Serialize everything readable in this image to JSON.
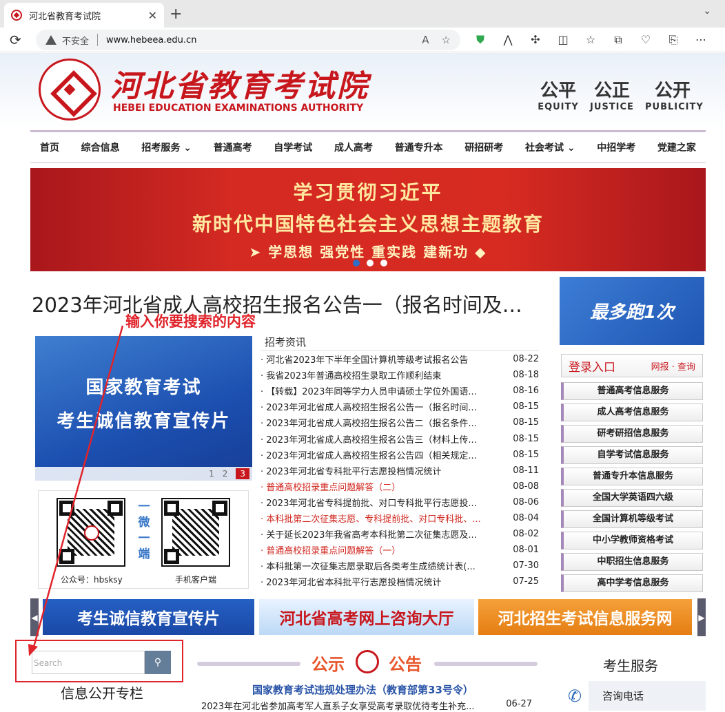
{
  "browser": {
    "tab_title": "河北省教育考试院",
    "close_glyph": "✕",
    "new_tab_glyph": "+",
    "tab_menu_glyph": "⌄",
    "reload_glyph": "⟳",
    "security_label": "不安全",
    "url": "www.hebeea.edu.cn",
    "read_aloud_glyph": "A",
    "favorite_glyph": "☆",
    "toolbar_icons": [
      {
        "name": "shield-icon",
        "glyph": "⛊"
      },
      {
        "name": "copilot-icon",
        "glyph": "⋀"
      },
      {
        "name": "extensions-icon",
        "glyph": "✣"
      },
      {
        "name": "split-screen-icon",
        "glyph": "◫"
      },
      {
        "name": "favorites-icon",
        "glyph": "☆"
      },
      {
        "name": "collections-icon",
        "glyph": "⧉"
      },
      {
        "name": "browser-essentials-icon",
        "glyph": "♡"
      },
      {
        "name": "share-icon",
        "glyph": "⎘"
      },
      {
        "name": "more-icon",
        "glyph": "⋯"
      }
    ]
  },
  "site": {
    "name_cn": "河北省教育考试院",
    "name_en": "HEBEI EDUCATION EXAMINATIONS AUTHORITY",
    "mottos": [
      {
        "cn": "公平",
        "en": "EQUITY"
      },
      {
        "cn": "公正",
        "en": "JUSTICE"
      },
      {
        "cn": "公开",
        "en": "PUBLICITY"
      }
    ]
  },
  "nav": [
    "首页",
    "综合信息",
    "招考服务 ⌄",
    "普通高考",
    "自学考试",
    "成人高考",
    "普通专升本",
    "研招研考",
    "社会考试 ⌄",
    "中招学考",
    "党建之家"
  ],
  "banner": {
    "line1": "学习贯彻习近平",
    "line2": "新时代中国特色社会主义思想主题教育",
    "line3": "➤ 学思想 强党性 重实践 建新功 ◆"
  },
  "headline": "2023年河北省成人高校招生报名公告一（报名时间及…",
  "annotation": "输入你要搜索的内容",
  "promo": {
    "line1": "国家教育考试",
    "line2": "考生诚信教育宣传片",
    "pages": [
      "1",
      "2",
      "3"
    ]
  },
  "qr": {
    "left_label": "公众号：hbsksy",
    "right_label": "手机客户端",
    "vertical": [
      "一",
      "微",
      "一",
      "端"
    ]
  },
  "news": {
    "title": "招考资讯",
    "items": [
      {
        "t": "· 河北省2023年下半年全国计算机等级考试报名公告",
        "d": "08-22",
        "red": false
      },
      {
        "t": "· 我省2023年普通高校招生录取工作顺利结束",
        "d": "08-18",
        "red": false
      },
      {
        "t": "· 【转载】2023年同等学力人员申请硕士学位外国语...",
        "d": "08-16",
        "red": false
      },
      {
        "t": "· 2023年河北省成人高校招生报名公告一（报名时间...",
        "d": "08-15",
        "red": false
      },
      {
        "t": "· 2023年河北省成人高校招生报名公告二（报名条件...",
        "d": "08-15",
        "red": false
      },
      {
        "t": "· 2023年河北省成人高校招生报名公告三（材料上传...",
        "d": "08-15",
        "red": false
      },
      {
        "t": "· 2023年河北省成人高校招生报名公告四（相关规定...",
        "d": "08-15",
        "red": false
      },
      {
        "t": "· 2023年河北省专科批平行志愿投档情况统计",
        "d": "08-11",
        "red": false
      },
      {
        "t": "· 普通高校招录重点问题解答（二）",
        "d": "08-08",
        "red": true
      },
      {
        "t": "· 2023年河北省专科提前批、对口专科批平行志愿投...",
        "d": "08-06",
        "red": false
      },
      {
        "t": "· 本科批第二次征集志愿、专科提前批、对口专科批、...",
        "d": "08-04",
        "red": true
      },
      {
        "t": "· 关于延长2023年我省高考本科批第二次征集志愿及...",
        "d": "08-02",
        "red": false
      },
      {
        "t": "· 普通高校招录重点问题解答（一）",
        "d": "08-01",
        "red": true
      },
      {
        "t": "· 本科批第一次征集志愿录取后各类考生成绩统计表(...",
        "d": "07-30",
        "red": false
      },
      {
        "t": "· 2023年河北省本科批平行志愿投档情况统计",
        "d": "07-25",
        "red": false
      }
    ]
  },
  "side": {
    "promo": "最多跑1次",
    "login_title": "登录入口",
    "login_sub": "网报 · 查询",
    "services": [
      "普通高考信息服务",
      "成人高考信息服务",
      "研考研招信息服务",
      "自学考试信息服务",
      "普通专升本信息服务",
      "全国大学英语四六级",
      "全国计算机等级考试",
      "中小学教师资格考试",
      "中职招生信息服务",
      "高中学考信息服务"
    ]
  },
  "links": [
    "考生诚信教育宣传片",
    "河北省高考网上咨询大厅",
    "河北招生考试信息服务网"
  ],
  "search": {
    "placeholder": "Search"
  },
  "notice": {
    "left": "公示",
    "right": "公告"
  },
  "bottom": {
    "candidate_service": "考生服务",
    "info_column": "信息公开专栏",
    "law": "国家教育考试违规处理办法（教育部第33号令）",
    "last_news": "2023年在河北省参加高考军人直系子女享受高考录取优待考生补充...",
    "last_date": "06-27",
    "consult": "咨询电话"
  },
  "colors": {
    "brand_red": "#c8161d",
    "annotation_red": "#e0242b",
    "nav_accent": "#ccb9d2"
  }
}
